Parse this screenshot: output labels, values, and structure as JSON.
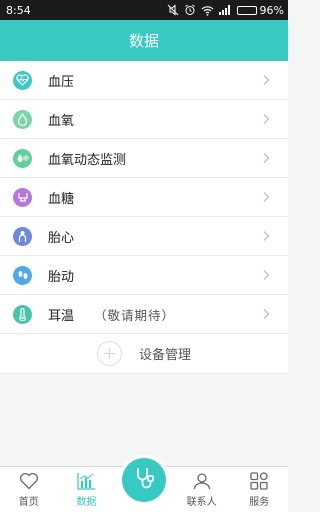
{
  "status_bar": {
    "time": "8:54",
    "battery_text": "96%",
    "battery_level": 0.96
  },
  "header": {
    "title": "数据"
  },
  "menu": {
    "items": [
      {
        "label": "血压",
        "sublabel": "",
        "icon": "heart-pulse-icon",
        "color": "#3ec7c8"
      },
      {
        "label": "血氧",
        "sublabel": "",
        "icon": "drop-icon",
        "color": "#7ad6a8"
      },
      {
        "label": "血氧动态监测",
        "sublabel": "",
        "icon": "drop-wave-icon",
        "color": "#62cf9e"
      },
      {
        "label": "血糖",
        "sublabel": "",
        "icon": "sugar-icon",
        "color": "#b777d8"
      },
      {
        "label": "胎心",
        "sublabel": "",
        "icon": "baby-heart-icon",
        "color": "#6d88e0"
      },
      {
        "label": "胎动",
        "sublabel": "",
        "icon": "footprint-icon",
        "color": "#4fa8e8"
      },
      {
        "label": "耳温",
        "sublabel": "（敬请期待）",
        "icon": "thermometer-icon",
        "color": "#49c3a7"
      }
    ]
  },
  "device_management": {
    "label": "设备管理"
  },
  "tabbar": {
    "tabs": [
      {
        "label": "首页",
        "icon": "heart-outline-icon"
      },
      {
        "label": "数据",
        "icon": "bar-chart-icon"
      },
      {
        "label": "",
        "icon": "stethoscope-icon"
      },
      {
        "label": "联系人",
        "icon": "contacts-icon"
      },
      {
        "label": "服务",
        "icon": "services-grid-icon"
      }
    ],
    "active_index": 1
  },
  "colors": {
    "primary": "#39c9c3",
    "status_bar": "#1b1b1b",
    "background": "#f4f5f5"
  }
}
